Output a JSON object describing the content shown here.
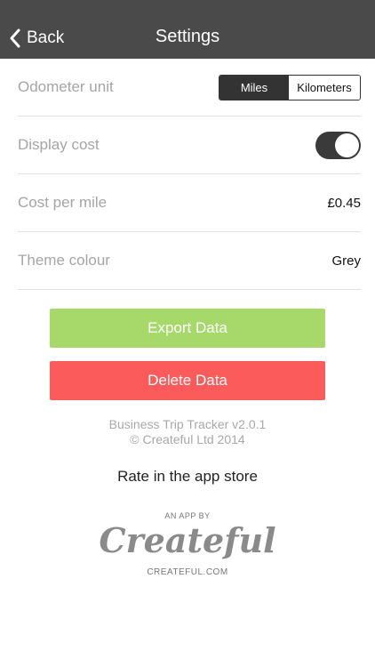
{
  "nav": {
    "back_label": "Back",
    "title": "Settings"
  },
  "rows": {
    "odometer": {
      "label": "Odometer unit",
      "options": [
        "Miles",
        "Kilometers"
      ],
      "selected": "Miles"
    },
    "display_cost": {
      "label": "Display cost",
      "enabled": true
    },
    "cost_per_mile": {
      "label": "Cost per mile",
      "value": "£0.45"
    },
    "theme": {
      "label": "Theme colour",
      "value": "Grey"
    }
  },
  "buttons": {
    "export": "Export Data",
    "delete": "Delete Data"
  },
  "colors": {
    "navbar": "#4a4a4a",
    "export": "#a7d86a",
    "delete": "#fb5b5b"
  },
  "footer": {
    "version": "Business Trip Tracker v2.0.1",
    "copyright": "© Createful Ltd 2014",
    "rate": "Rate in the app store",
    "app_by": "AN APP BY",
    "logo": "Createful",
    "website": "CREATEFUL.COM"
  }
}
